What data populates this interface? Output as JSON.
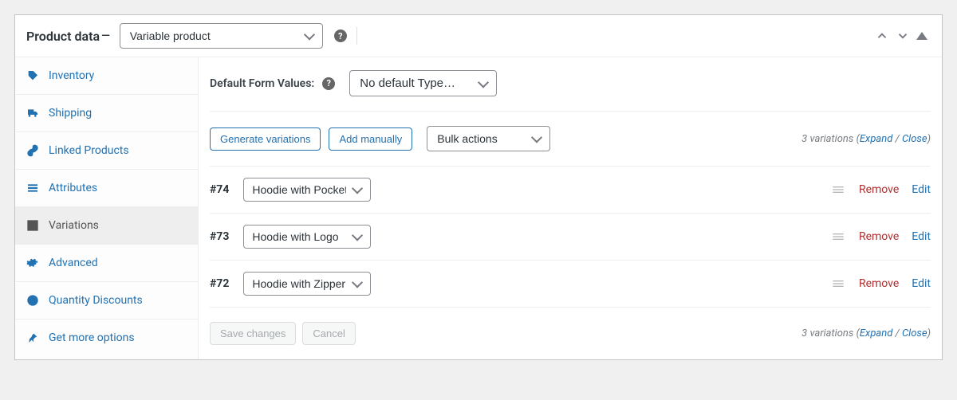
{
  "header": {
    "title": "Product data",
    "dash": "—",
    "product_type_options": [
      "Variable product"
    ],
    "product_type_selected": "Variable product"
  },
  "tabs": [
    {
      "key": "inventory",
      "label": "Inventory",
      "icon": "tag"
    },
    {
      "key": "shipping",
      "label": "Shipping",
      "icon": "truck"
    },
    {
      "key": "linked",
      "label": "Linked Products",
      "icon": "link"
    },
    {
      "key": "attributes",
      "label": "Attributes",
      "icon": "list"
    },
    {
      "key": "variations",
      "label": "Variations",
      "icon": "grid",
      "active": true
    },
    {
      "key": "advanced",
      "label": "Advanced",
      "icon": "gear"
    },
    {
      "key": "discounts",
      "label": "Quantity Discounts",
      "icon": "dollar"
    },
    {
      "key": "more",
      "label": "Get more options",
      "icon": "pin"
    }
  ],
  "default_form": {
    "label": "Default Form Values:",
    "selected": "No default Type…"
  },
  "actions": {
    "generate": "Generate variations",
    "add": "Add manually",
    "bulk_selected": "Bulk actions"
  },
  "meta": {
    "count_text": "3 variations",
    "expand": "Expand",
    "close": "Close"
  },
  "variations": [
    {
      "id": "#74",
      "selected": "Hoodie with Pocket"
    },
    {
      "id": "#73",
      "selected": "Hoodie with Logo"
    },
    {
      "id": "#72",
      "selected": "Hoodie with Zipper"
    }
  ],
  "row_actions": {
    "remove": "Remove",
    "edit": "Edit"
  },
  "footer": {
    "save": "Save changes",
    "cancel": "Cancel"
  }
}
